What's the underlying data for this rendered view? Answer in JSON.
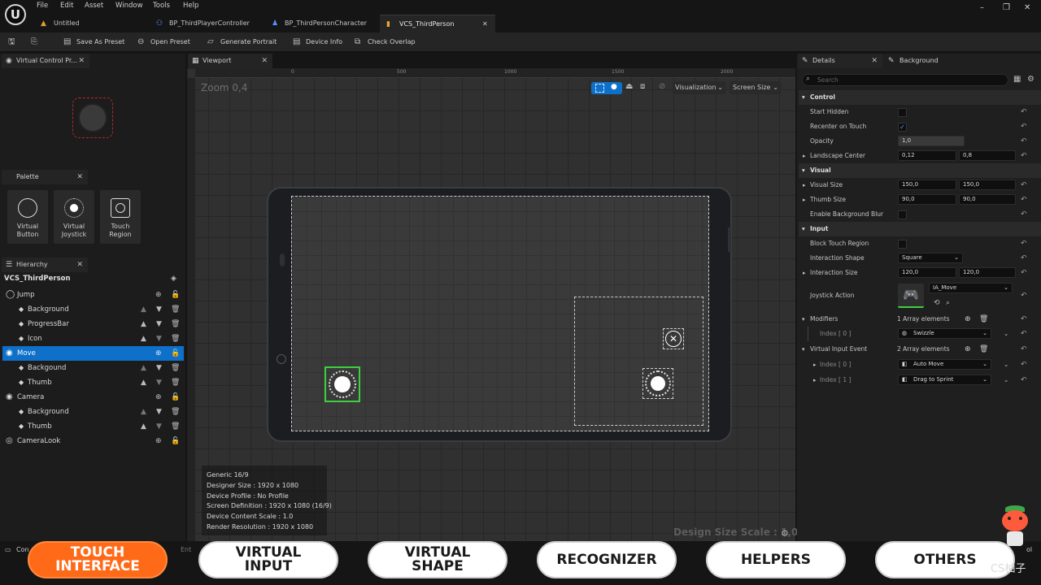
{
  "menu": [
    "File",
    "Edit",
    "Asset",
    "Window",
    "Tools",
    "Help"
  ],
  "doc_tabs": [
    "Untitled",
    "BP_ThirdPlayerController",
    "BP_ThirdPersonCharacter",
    "VCS_ThirdPerson"
  ],
  "toolbar": {
    "save_preset": "Save As Preset",
    "open_preset": "Open Preset",
    "generate_portrait": "Generate Portrait",
    "device_info": "Device Info",
    "check_overlap": "Check Overlap"
  },
  "preview_panel": {
    "title": "Virtual Control Pr..."
  },
  "palette": {
    "title": "Palette",
    "items": [
      "Virtual\nButton",
      "Virtual\nJoystick",
      "Touch\nRegion"
    ]
  },
  "hierarchy": {
    "title": "Hierarchy",
    "root": "VCS_ThirdPerson",
    "rows": [
      "Jump",
      "Background",
      "ProgressBar",
      "Icon",
      "Move",
      "Backgound",
      "Thumb",
      "Camera",
      "Background",
      "Thumb",
      "CameraLook"
    ]
  },
  "viewport": {
    "title": "Viewport",
    "zoom": "Zoom 0,4",
    "ruler_ticks": [
      "0",
      "500",
      "1000",
      "1500",
      "2000"
    ],
    "visualization": "Visualization",
    "screen_size": "Screen Size",
    "design_scale": "Design Size Scale : 1,0",
    "info": [
      "Generic 16/9",
      "Designer Size : 1920 x 1080",
      "Device Profile : No Profile",
      "Screen Definition : 1920 x 1080 (16/9)",
      "Device Content Scale : 1.0",
      "Render Resolution : 1920 x 1080"
    ]
  },
  "details": {
    "tab": "Details",
    "tab2": "Background",
    "search_placeholder": "Search",
    "control": "Control",
    "start_hidden": "Start Hidden",
    "recenter": "Recenter on Touch",
    "opacity": "Opacity",
    "opacity_val": "1,0",
    "landscape_center": "Landscape Center",
    "lc_x": "0,12",
    "lc_y": "0,8",
    "visual": "Visual",
    "visual_size": "Visual Size",
    "vs_x": "150,0",
    "vs_y": "150,0",
    "thumb_size": "Thumb Size",
    "ts_x": "90,0",
    "ts_y": "90,0",
    "enable_blur": "Enable Background Blur",
    "input": "Input",
    "block_touch": "Block Touch Region",
    "interaction_shape": "Interaction Shape",
    "interaction_shape_val": "Square",
    "interaction_size": "Interaction Size",
    "is_x": "120,0",
    "is_y": "120,0",
    "joystick_action": "Joystick Action",
    "joystick_action_val": "IA_Move",
    "modifiers": "Modifiers",
    "modifiers_count": "1 Array elements",
    "index0": "Index [ 0 ]",
    "index1": "Index [ 1 ]",
    "swizzle": "Swizzle",
    "vie": "Virtual Input Event",
    "vie_count": "2 Array elements",
    "auto_move": "Auto Move",
    "drag_sprint": "Drag to Sprint"
  },
  "bottom": {
    "content_drawer": "Con",
    "enter_cmd": "Ent",
    "pills": [
      "TOUCH\nINTERFACE",
      "VIRTUAL\nINPUT",
      "VIRTUAL\nSHAPE",
      "RECOGNIZER",
      "HELPERS",
      "OTHERS"
    ],
    "watermark": "CS柚子",
    "tail": "ol"
  },
  "colors": {
    "accent": "#0e70c8",
    "active_pill": "#ff6a19",
    "selection_green": "#3ecf3e"
  }
}
